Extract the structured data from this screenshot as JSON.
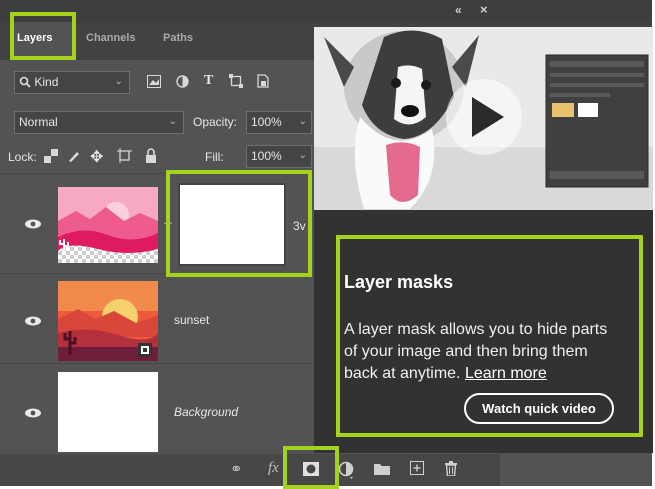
{
  "window": {
    "collapse_label": "«",
    "close_label": "×"
  },
  "tabs": [
    {
      "label": "Layers",
      "active": true
    },
    {
      "label": "Channels",
      "active": false
    },
    {
      "label": "Paths",
      "active": false
    }
  ],
  "filter": {
    "kind_label": "Kind"
  },
  "blend": {
    "mode": "Normal",
    "opacity_label": "Opacity:",
    "opacity_value": "100%"
  },
  "lock": {
    "label": "Lock:",
    "fill_label": "Fill:",
    "fill_value": "100%"
  },
  "layers": [
    {
      "name": "3v",
      "italic": false
    },
    {
      "name": "sunset",
      "italic": false
    },
    {
      "name": "Background",
      "italic": true
    }
  ],
  "tooltip": {
    "title": "Layer masks",
    "body": "A layer mask allows you to hide parts of your image and then bring them back at anytime.",
    "link": "Learn more",
    "button": "Watch quick video"
  },
  "colors": {
    "highlight": "#a7d21c",
    "panel": "#535353",
    "tooltip": "#323232"
  }
}
